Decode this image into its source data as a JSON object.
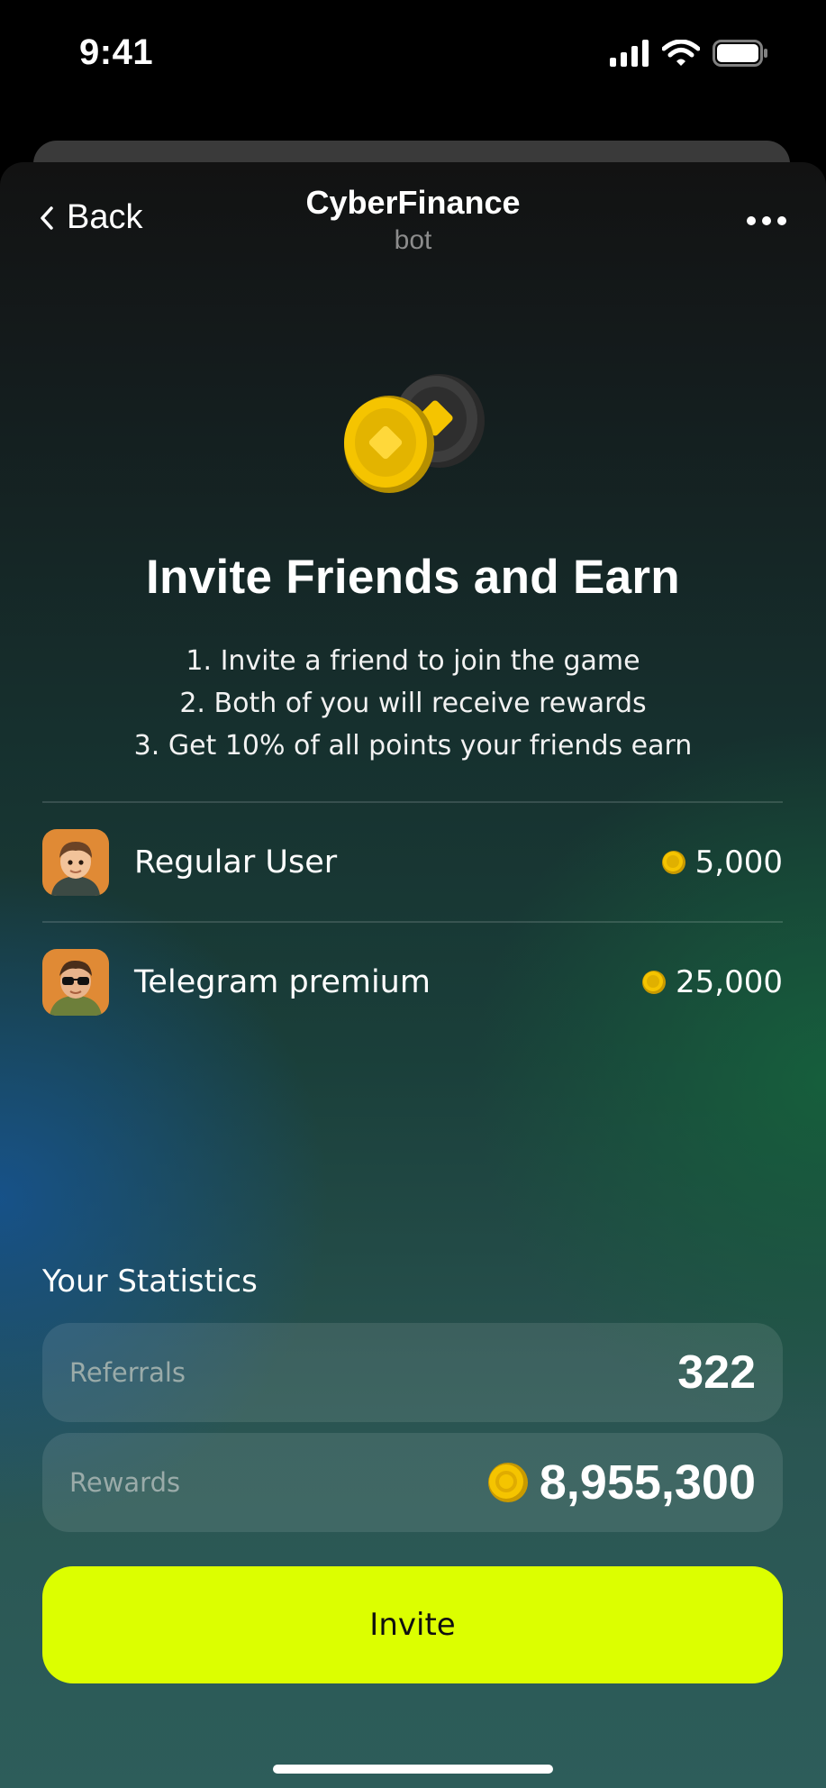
{
  "status_bar": {
    "time": "9:41"
  },
  "nav": {
    "back_label": "Back",
    "title": "CyberFinance",
    "subtitle": "bot"
  },
  "hero": {
    "icon": "coins-icon"
  },
  "headline": "Invite Friends and Earn",
  "steps": [
    "1. Invite a friend to join the game",
    "2. Both of you will receive rewards",
    "3. Get 10% of all points your friends earn"
  ],
  "tiers": [
    {
      "name": "Regular User",
      "reward": "5,000",
      "avatar": "boy-avatar-icon"
    },
    {
      "name": "Telegram premium",
      "reward": "25,000",
      "avatar": "boy-sunglasses-avatar-icon"
    }
  ],
  "stats": {
    "title": "Your Statistics",
    "referrals_label": "Referrals",
    "referrals_value": "322",
    "rewards_label": "Rewards",
    "rewards_value": "8,955,300"
  },
  "invite_button": "Invite",
  "colors": {
    "accent": "#dcff00",
    "coin": "#f5c400"
  }
}
